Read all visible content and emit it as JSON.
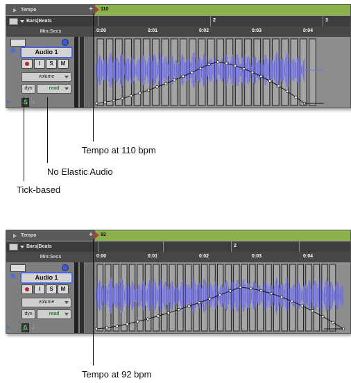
{
  "panel_top": {
    "tempo_label": "Tempo",
    "bars_label": "Bars|Beats",
    "minsecs_label": "Min:Secs",
    "tempo_value": "110",
    "bar_ticks": [
      "2",
      "3"
    ],
    "sec_ticks": [
      "0:00",
      "0:01",
      "0:02",
      "0:03",
      "0:04"
    ],
    "track": {
      "name": "Audio 1",
      "input_label": "I",
      "solo_label": "S",
      "mute_label": "M",
      "view_selector": "volume",
      "dyn_label": "dyn",
      "automation_mode": "read"
    }
  },
  "panel_bottom": {
    "tempo_label": "Tempo",
    "bars_label": "Bars|Beats",
    "minsecs_label": "Min:Secs",
    "tempo_value": "92",
    "bar_ticks": [
      "2"
    ],
    "sec_ticks": [
      "0:00",
      "0:01",
      "0:02",
      "0:03",
      "0:04"
    ],
    "track": {
      "name": "Audio 1",
      "input_label": "I",
      "solo_label": "S",
      "mute_label": "M",
      "view_selector": "volume",
      "dyn_label": "dyn",
      "automation_mode": "read"
    }
  },
  "callouts": {
    "tempo_110": "Tempo at 110 bpm",
    "no_elastic": "No Elastic Audio",
    "tick_based": "Tick-based",
    "tempo_92": "Tempo at 92 bpm"
  },
  "colors": {
    "tempo_ruler": "#8bb14c",
    "waveform": "#6b6bf0",
    "track_name_outline": "#4a64d8",
    "read_mode": "#2a7a2a"
  }
}
